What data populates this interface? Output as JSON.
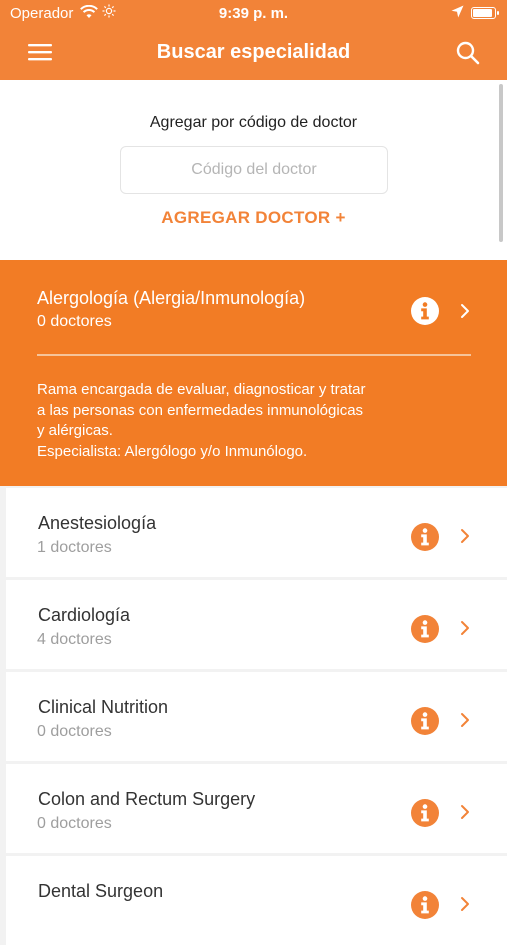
{
  "status_bar": {
    "carrier": "Operador",
    "time": "9:39 p. m.",
    "battery_level": 0.95
  },
  "nav": {
    "title": "Buscar especialidad",
    "menu_icon": "hamburger-menu-icon",
    "search_icon": "search-icon"
  },
  "add_doctor": {
    "label": "Agregar por código de doctor",
    "input_placeholder": "Código del doctor",
    "input_value": "",
    "button_label": "AGREGAR DOCTOR +"
  },
  "specialties": [
    {
      "name": "Alergología (Alergia/Inmunología)",
      "count": "0 doctores",
      "expanded": true,
      "description_lines": [
        "Rama encargada de evaluar, diagnosticar y tratar",
        "a las personas con enfermedades inmunológicas",
        "y alérgicas.",
        "Especialista: Alergólogo y/o Inmunólogo."
      ]
    },
    {
      "name": "Anestesiología",
      "count": "1 doctores"
    },
    {
      "name": "Cardiología",
      "count": "4 doctores"
    },
    {
      "name": "Clinical Nutrition",
      "count": "0 doctores"
    },
    {
      "name": "Colon and Rectum Surgery",
      "count": "0 doctores"
    },
    {
      "name": "Dental Surgeon",
      "count": ""
    }
  ],
  "colors": {
    "accent": "#f28338",
    "expanded_bg": "#f27c25",
    "muted_text": "#9e9e9e"
  }
}
